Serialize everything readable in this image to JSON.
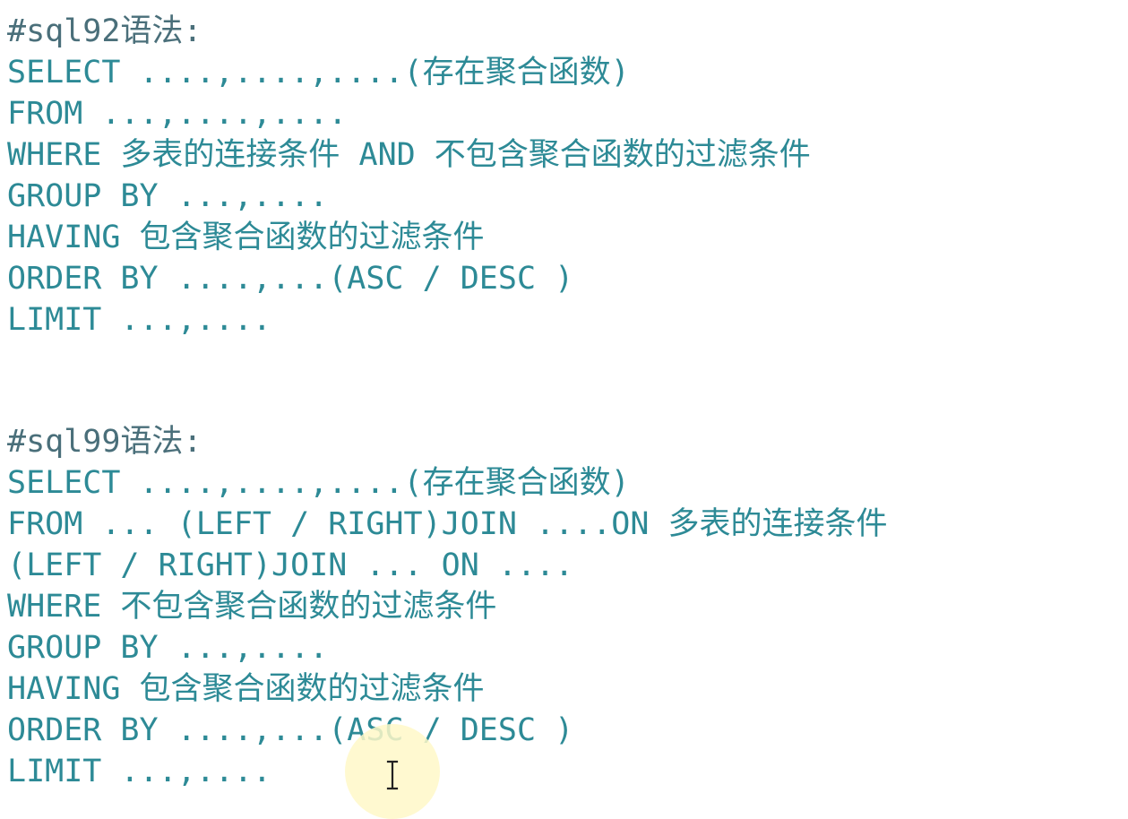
{
  "sql92": {
    "comment": "#sql92语法:",
    "lines": [
      "SELECT ....,....,....(存在聚合函数)",
      "FROM ...,....,....",
      "WHERE 多表的连接条件 AND 不包含聚合函数的过滤条件",
      "GROUP BY ...,....",
      "HAVING 包含聚合函数的过滤条件",
      "ORDER BY ....,...(ASC / DESC )",
      "LIMIT ...,...."
    ]
  },
  "sql99": {
    "comment": "#sql99语法:",
    "lines": [
      "SELECT ....,....,....(存在聚合函数)",
      "FROM ... (LEFT / RIGHT)JOIN ....ON 多表的连接条件",
      "(LEFT / RIGHT)JOIN ... ON ....",
      "WHERE 不包含聚合函数的过滤条件",
      "GROUP BY ...,....",
      "HAVING 包含聚合函数的过滤条件",
      "ORDER BY ....,...(ASC / DESC )",
      "LIMIT ...,...."
    ]
  },
  "cursor": {
    "icon": "text-cursor-icon",
    "highlight_color": "#fff8c8"
  },
  "colors": {
    "text": "#2d8a96",
    "comment": "#4a6f7a",
    "background": "#ffffff"
  }
}
